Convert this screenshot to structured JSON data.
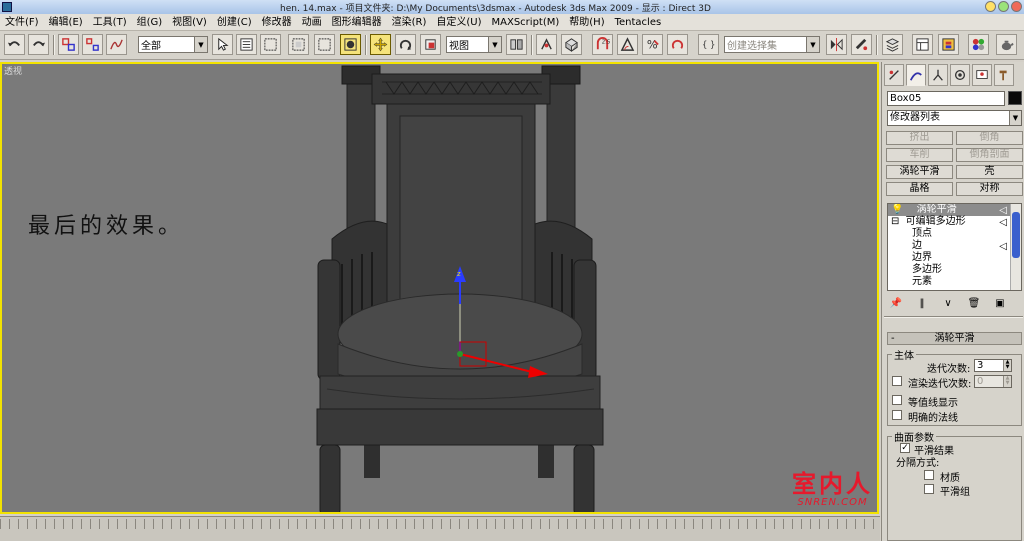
{
  "window": {
    "title": "hen. 14.max    - 项目文件夹: D:\\My Documents\\3dsmax    - Autodesk 3ds Max  2009    - 显示 : Direct 3D"
  },
  "menubar": {
    "items": [
      "文件(F)",
      "编辑(E)",
      "工具(T)",
      "组(G)",
      "视图(V)",
      "创建(C)",
      "修改器",
      "动画",
      "图形编辑器",
      "渲染(R)",
      "自定义(U)",
      "MAXScript(M)",
      "帮助(H)",
      "Tentacles"
    ]
  },
  "toolbar": {
    "selection_filter": "全部",
    "reference_coord": "视图",
    "named_selection_placeholder": "创建选择集"
  },
  "viewport": {
    "label": "透视",
    "caption": "最后的效果。",
    "border_color": "#f2e200"
  },
  "watermark": {
    "main": "室内人",
    "sub": "SNREN.COM",
    "color": "#e6192c"
  },
  "command_panel": {
    "object_name": "Box05",
    "object_color": "#0a0a0a",
    "modifier_list": "修改器列表",
    "buttons": [
      {
        "label": "挤出",
        "enabled": false
      },
      {
        "label": "倒角",
        "enabled": false
      },
      {
        "label": "车削",
        "enabled": false
      },
      {
        "label": "倒角剖面",
        "enabled": false
      },
      {
        "label": "涡轮平滑",
        "enabled": true
      },
      {
        "label": "壳",
        "enabled": true
      },
      {
        "label": "晶格",
        "enabled": true
      },
      {
        "label": "对称",
        "enabled": true
      }
    ],
    "stack": {
      "items": [
        "涡轮平滑",
        "可编辑多边形",
        "顶点",
        "边",
        "边界",
        "多边形",
        "元素"
      ]
    },
    "rollout": {
      "title": "涡轮平滑",
      "main_group": "主体",
      "iterations_label": "迭代次数:",
      "iterations_value": "3",
      "render_iters_label": "渲染迭代次数:",
      "render_iters_value": "0",
      "isoline_label": "等值线显示",
      "explicit_normals_label": "明确的法线",
      "surface_group": "曲面参数",
      "smooth_result_label": "平滑结果",
      "separate_by_label": "分隔方式:",
      "material_label": "材质",
      "smoothing_groups_label": "平滑组"
    }
  }
}
